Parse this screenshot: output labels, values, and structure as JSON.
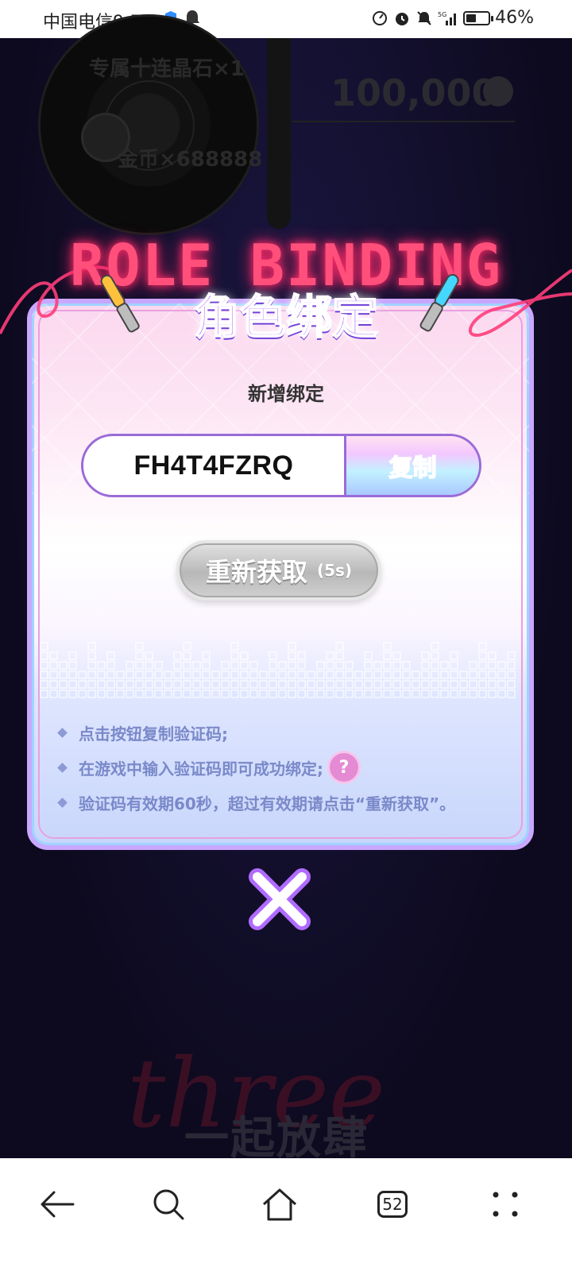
{
  "status_bar": {
    "carrier_time": "中国电信9:55",
    "battery_percent": "46%",
    "battery_level": 0.46,
    "icons": [
      "shield-icon",
      "bell-icon",
      "data-saver-icon",
      "alarm-icon",
      "mute-icon",
      "signal-5g-icon",
      "battery-icon"
    ]
  },
  "background_page": {
    "reward_1": "专属十连晶石×1",
    "reward_2": "金币×688888",
    "participant_count": "100,000",
    "banner_script": "three",
    "banner_slogan": "一起放肆"
  },
  "dialog": {
    "title_en": "ROLE BINDING",
    "title_cn": "角色绑定",
    "section_title": "新增绑定",
    "verification_code": "FH4T4FZRQ",
    "copy_button_label": "复制",
    "refresh_button_label": "重新获取",
    "refresh_countdown": "(5s)",
    "tips": [
      "点击按钮复制验证码;",
      "在游戏中输入验证码即可成功绑定;",
      "验证码有效期60秒，超过有效期请点击“重新获取”。"
    ],
    "help_icon_label": "?"
  },
  "bottom_nav": {
    "tab_count": "52",
    "items": [
      "back-icon",
      "search-icon",
      "home-icon",
      "tabs-icon",
      "more-icon"
    ]
  },
  "colors": {
    "accent_purple": "#b06bff",
    "neon_pink": "#ff4f7a",
    "tip_text": "#7a89c9",
    "help_pink": "#e58bd4"
  }
}
